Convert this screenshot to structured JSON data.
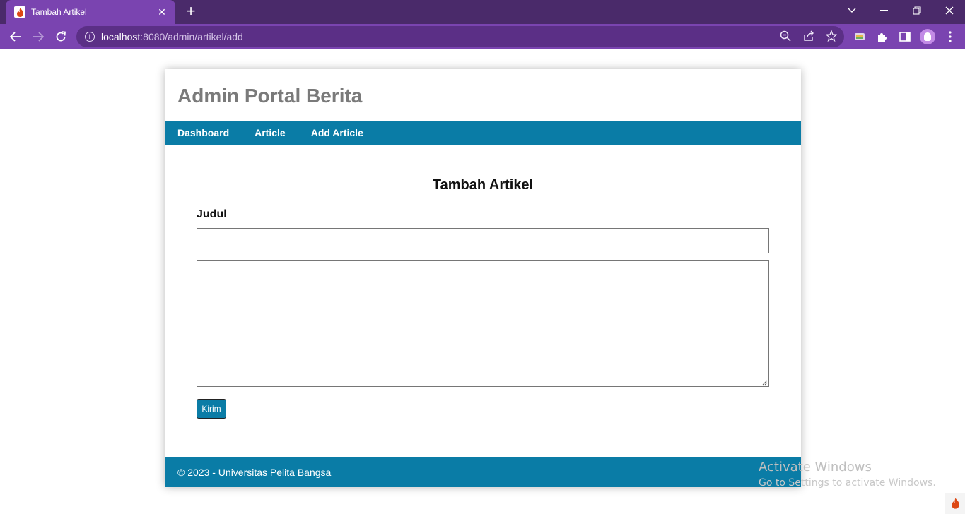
{
  "browser": {
    "tab_title": "Tambah Artikel",
    "tab_close": "✕",
    "new_tab": "+",
    "url_host": "localhost",
    "url_path": ":8080/admin/artikel/add",
    "accent": "#7a44b0",
    "titlebar_color": "#4a2a6a"
  },
  "site": {
    "title": "Admin Portal Berita",
    "nav": [
      "Dashboard",
      "Article",
      "Add Article"
    ],
    "brand_color": "#0a7ca6"
  },
  "form": {
    "heading": "Tambah Artikel",
    "judul_label": "Judul",
    "judul_value": "",
    "isi_value": "",
    "submit_label": "Kirim"
  },
  "footer": {
    "text": "© 2023 - Universitas Pelita Bangsa"
  },
  "os": {
    "watermark_line1": "Activate Windows",
    "watermark_line2": "Go to Settings to activate Windows."
  }
}
